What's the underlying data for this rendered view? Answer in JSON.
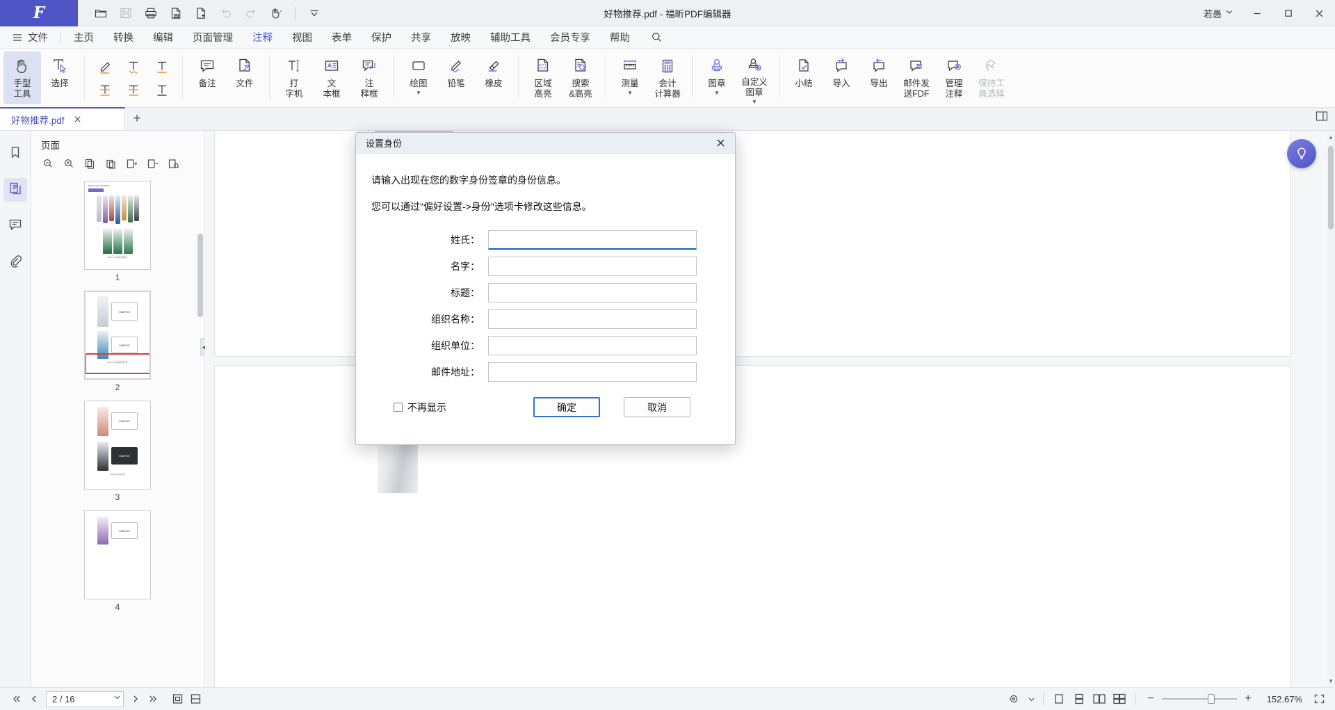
{
  "titlebar": {
    "doc_title": "好物推荐.pdf - 福昕PDF编辑器",
    "user_name": "若愚",
    "logo_glyph": "F",
    "quick_access": [
      {
        "name": "open-file-icon",
        "label": "打开"
      },
      {
        "name": "save-icon",
        "label": "保存"
      },
      {
        "name": "print-icon",
        "label": "打印"
      },
      {
        "name": "save-as-icon",
        "label": "另存为"
      },
      {
        "name": "new-file-icon",
        "label": "新建"
      },
      {
        "name": "undo-icon",
        "label": "撤销"
      },
      {
        "name": "redo-icon",
        "label": "重做"
      },
      {
        "name": "hand-tool-icon",
        "label": "手型工具"
      },
      {
        "name": "customize-qat-icon",
        "label": "自定义快速访问工具栏"
      }
    ],
    "window_buttons": [
      "minimize",
      "maximize",
      "close"
    ]
  },
  "menubar": {
    "hamburger": "menu-icon",
    "items": [
      {
        "label": "文件",
        "active": false
      },
      {
        "label": "主页",
        "active": false
      },
      {
        "label": "转换",
        "active": false
      },
      {
        "label": "编辑",
        "active": false
      },
      {
        "label": "页面管理",
        "active": false
      },
      {
        "label": "注释",
        "active": true
      },
      {
        "label": "视图",
        "active": false
      },
      {
        "label": "表单",
        "active": false
      },
      {
        "label": "保护",
        "active": false
      },
      {
        "label": "共享",
        "active": false
      },
      {
        "label": "放映",
        "active": false
      },
      {
        "label": "辅助工具",
        "active": false
      },
      {
        "label": "会员专享",
        "active": false
      },
      {
        "label": "帮助",
        "active": false
      }
    ],
    "search_icon": "search-icon"
  },
  "ribbon": {
    "groups": [
      {
        "name": "select-group",
        "items": [
          {
            "label": "手型\n工具",
            "icon": "hand-icon",
            "selected": true,
            "dropdown": false
          },
          {
            "label": "选择",
            "icon": "select-text-icon",
            "selected": false,
            "dropdown": true
          }
        ]
      },
      {
        "name": "text-markup-group",
        "grid": [
          {
            "icon": "highlight-icon",
            "label": "高亮"
          },
          {
            "icon": "squiggly-icon",
            "label": "波浪线"
          },
          {
            "icon": "underline-icon",
            "label": "下划线"
          },
          {
            "icon": "strikeout-icon",
            "label": "删除线"
          },
          {
            "icon": "replace-text-icon",
            "label": "替换文本"
          },
          {
            "icon": "insert-text-icon",
            "label": "插入文本"
          }
        ]
      },
      {
        "name": "note-group",
        "items": [
          {
            "label": "备注",
            "icon": "comment-icon"
          },
          {
            "label": "文件",
            "icon": "file-attach-icon"
          }
        ]
      },
      {
        "name": "typewriter-group",
        "items": [
          {
            "label": "打\n字机",
            "icon": "typewriter-icon"
          },
          {
            "label": "文\n本框",
            "icon": "textbox-icon"
          },
          {
            "label": "注\n释框",
            "icon": "callout-icon"
          }
        ]
      },
      {
        "name": "drawing-group",
        "items": [
          {
            "label": "绘图",
            "icon": "shapes-icon",
            "dropdown": true
          },
          {
            "label": "铅笔",
            "icon": "pencil-icon"
          },
          {
            "label": "橡皮",
            "icon": "eraser-icon"
          }
        ]
      },
      {
        "name": "highlight-group",
        "items": [
          {
            "label": "区域\n高亮",
            "icon": "area-highlight-icon"
          },
          {
            "label": "搜索\n&高亮",
            "icon": "search-highlight-icon"
          }
        ]
      },
      {
        "name": "measure-group",
        "items": [
          {
            "label": "测量",
            "icon": "ruler-icon",
            "dropdown": true
          },
          {
            "label": "会计\n计算器",
            "icon": "calculator-icon"
          }
        ]
      },
      {
        "name": "stamp-group",
        "items": [
          {
            "label": "图章",
            "icon": "stamp-icon",
            "dropdown": true
          },
          {
            "label": "自定义\n图章",
            "icon": "custom-stamp-icon",
            "dropdown": true
          }
        ]
      },
      {
        "name": "manage-group",
        "items": [
          {
            "label": "小结",
            "icon": "summary-icon"
          },
          {
            "label": "导入",
            "icon": "import-comment-icon"
          },
          {
            "label": "导出",
            "icon": "export-comment-icon"
          },
          {
            "label": "邮件发\n送FDF",
            "icon": "mail-fdf-icon"
          },
          {
            "label": "管理\n注释",
            "icon": "manage-comment-icon",
            "dropdown": true
          },
          {
            "label": "保持工\n具选择",
            "icon": "keep-tool-icon",
            "disabled": true
          }
        ]
      }
    ]
  },
  "tabstrip": {
    "tabs": [
      {
        "label": "好物推荐.pdf",
        "active": true
      }
    ],
    "new_tab": "+",
    "right_icon": "split-view-icon"
  },
  "left_rail": {
    "items": [
      {
        "name": "bookmarks-icon",
        "label": "书签",
        "active": false
      },
      {
        "name": "pages-icon",
        "label": "页面",
        "active": true
      },
      {
        "name": "comments-icon",
        "label": "注释",
        "active": false
      },
      {
        "name": "attachments-icon",
        "label": "附件",
        "active": false
      }
    ]
  },
  "panel": {
    "title": "页面",
    "tools": [
      {
        "name": "zoom-out-page-icon"
      },
      {
        "name": "zoom-in-page-icon"
      },
      {
        "name": "copy-page-icon"
      },
      {
        "name": "paste-page-icon"
      },
      {
        "name": "insert-page-icon"
      },
      {
        "name": "delete-page-icon"
      },
      {
        "name": "extract-page-icon"
      }
    ],
    "thumbnails": [
      {
        "page": "1",
        "selected": false
      },
      {
        "page": "2",
        "selected": true
      },
      {
        "page": "3",
        "selected": false
      },
      {
        "page": "4",
        "selected": false
      }
    ]
  },
  "dialog": {
    "title": "设置身份",
    "close_icon": "close-icon",
    "paragraph1": "请输入出现在您的数字身份签章的身份信息。",
    "paragraph2": "您可以通过\"偏好设置->身份\"选项卡修改这些信息。",
    "fields": [
      {
        "label": "姓氏：",
        "value": "",
        "focused": true
      },
      {
        "label": "名字：",
        "value": "",
        "focused": false
      },
      {
        "label": "标题：",
        "value": "",
        "focused": false
      },
      {
        "label": "组织名称：",
        "value": "",
        "focused": false
      },
      {
        "label": "组织单位：",
        "value": "",
        "focused": false
      },
      {
        "label": "邮件地址：",
        "value": "",
        "focused": false
      }
    ],
    "checkbox": {
      "label": "不再显示",
      "checked": false
    },
    "ok_button": "确定",
    "cancel_button": "取消"
  },
  "statusbar": {
    "first_page_icon": "first-page-icon",
    "prev_page_icon": "prev-page-icon",
    "page_value": "2 / 16",
    "next_page_icon": "next-page-icon",
    "last_page_icon": "last-page-icon",
    "fit_page_icon": "fit-page-icon",
    "fit_width_icon": "fit-width-icon",
    "view_modes": [
      {
        "name": "rotate-view-icon"
      },
      {
        "name": "single-page-icon"
      },
      {
        "name": "continuous-page-icon"
      },
      {
        "name": "facing-page-icon"
      },
      {
        "name": "facing-continuous-icon"
      }
    ],
    "zoom_out": "−",
    "zoom_in": "+",
    "zoom_value": "152.67%",
    "fullscreen_icon": "fullscreen-icon"
  },
  "ai_assistant": {
    "name": "ai-bubble-icon"
  },
  "colors": {
    "brand": "#4f55c4",
    "accent_focus": "#0a66c2",
    "primary_btn_border": "#2f6fd0",
    "selection_red": "#e53935",
    "titlebar_bg": "#eef0f3",
    "ribbon_bg": "#fbfbfc"
  }
}
